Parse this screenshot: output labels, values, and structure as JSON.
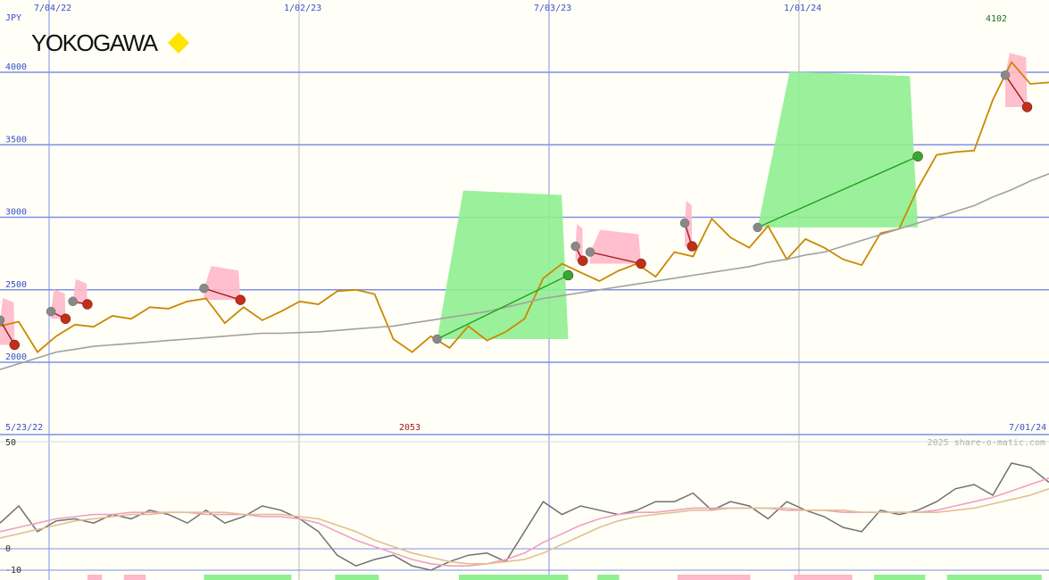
{
  "brand": {
    "name": "YOKOGAWA",
    "icon": "yellow-diamond-icon"
  },
  "colors": {
    "background": "#fffff8",
    "grid_major": "#7f8fe8",
    "grid_minor": "#b8b8b8",
    "price_line": "#cc8800",
    "moving_avg": "#a0a0a0",
    "up_fill": "#90f090",
    "down_fill": "#ffb8c8",
    "up_trend": "#22a022",
    "down_trend": "#a01818",
    "label_blue": "#3b4ec8",
    "label_red": "#a01818",
    "label_green": "#207020",
    "osc_main": "#707070",
    "osc_pink": "#f0a0c0",
    "osc_tan": "#e0c090"
  },
  "chart_data": [
    {
      "type": "line",
      "name": "price",
      "unit_label": "JPY",
      "x_tick_labels": [
        "7/04/22",
        "1/02/23",
        "7/03/23",
        "1/01/24"
      ],
      "y_ticks": [
        2000,
        2500,
        3000,
        3500,
        4000
      ],
      "ylim": [
        1970,
        4380
      ],
      "start_date_label": "5/23/22",
      "end_date_label": "7/01/24",
      "min_label": "2053",
      "max_label": "4102",
      "x_weeks": [
        0,
        2,
        4,
        6,
        8,
        10,
        12,
        14,
        16,
        18,
        20,
        22,
        24,
        26,
        28,
        30,
        32,
        34,
        36,
        38,
        40,
        42,
        44,
        46,
        48,
        50,
        52,
        54,
        56,
        58,
        60,
        62,
        64,
        66,
        68,
        70,
        72,
        74,
        76,
        78,
        80,
        82,
        84,
        86,
        88,
        90,
        92,
        94,
        96,
        98,
        100,
        102,
        104,
        106,
        108,
        110,
        112
      ],
      "series": [
        {
          "name": "price",
          "values": [
            2250,
            2280,
            2070,
            2180,
            2260,
            2245,
            2320,
            2300,
            2380,
            2370,
            2420,
            2440,
            2270,
            2380,
            2290,
            2350,
            2420,
            2400,
            2490,
            2500,
            2470,
            2160,
            2070,
            2180,
            2100,
            2250,
            2150,
            2210,
            2300,
            2580,
            2680,
            2620,
            2560,
            2630,
            2680,
            2590,
            2760,
            2730,
            2990,
            2860,
            2790,
            2940,
            2710,
            2850,
            2790,
            2710,
            2670,
            2890,
            2920,
            3200,
            3430,
            3450,
            3460,
            3810,
            4070,
            3920,
            3930
          ]
        },
        {
          "name": "moving average",
          "values": [
            1950,
            1990,
            2030,
            2070,
            2090,
            2110,
            2120,
            2130,
            2140,
            2150,
            2160,
            2170,
            2180,
            2190,
            2200,
            2200,
            2205,
            2210,
            2220,
            2230,
            2240,
            2250,
            2270,
            2290,
            2310,
            2330,
            2350,
            2380,
            2410,
            2440,
            2460,
            2480,
            2500,
            2520,
            2540,
            2560,
            2580,
            2600,
            2620,
            2640,
            2660,
            2690,
            2710,
            2740,
            2760,
            2800,
            2840,
            2880,
            2920,
            2960,
            3000,
            3040,
            3080,
            3140,
            3190,
            3250,
            3300
          ]
        }
      ],
      "trend_markers": [
        {
          "from": [
            0,
            2290
          ],
          "to": [
            2,
            2120
          ],
          "dir": "down"
        },
        {
          "from": [
            7,
            2350
          ],
          "to": [
            9,
            2300
          ],
          "dir": "down"
        },
        {
          "from": [
            10,
            2420
          ],
          "to": [
            12,
            2400
          ],
          "dir": "down"
        },
        {
          "from": [
            28,
            2510
          ],
          "to": [
            33,
            2430
          ],
          "dir": "down"
        },
        {
          "from": [
            60,
            2160
          ],
          "to": [
            78,
            2600
          ],
          "dir": "up"
        },
        {
          "from": [
            79,
            2800
          ],
          "to": [
            80,
            2700
          ],
          "dir": "down"
        },
        {
          "from": [
            81,
            2760
          ],
          "to": [
            88,
            2680
          ],
          "dir": "down"
        },
        {
          "from": [
            94,
            2960
          ],
          "to": [
            95,
            2800
          ],
          "dir": "down"
        },
        {
          "from": [
            104,
            2930
          ],
          "to": [
            126,
            3420
          ],
          "dir": "up"
        },
        {
          "from": [
            138,
            3980
          ],
          "to": [
            141,
            3760
          ],
          "dir": "down"
        }
      ]
    },
    {
      "type": "line",
      "name": "oscillator",
      "y_ticks": [
        50,
        0,
        -10
      ],
      "ylim": [
        -12,
        52
      ],
      "attribution": "2025 share-o-matic.com",
      "x_weeks": [
        0,
        2,
        4,
        6,
        8,
        10,
        12,
        14,
        16,
        18,
        20,
        22,
        24,
        26,
        28,
        30,
        32,
        34,
        36,
        38,
        40,
        42,
        44,
        46,
        48,
        50,
        52,
        54,
        56,
        58,
        60,
        62,
        64,
        66,
        68,
        70,
        72,
        74,
        76,
        78,
        80,
        82,
        84,
        86,
        88,
        90,
        92,
        94,
        96,
        98,
        100,
        102,
        104,
        106,
        108,
        110,
        112
      ],
      "series": [
        {
          "name": "main",
          "values": [
            12,
            20,
            8,
            13,
            14,
            12,
            16,
            14,
            18,
            16,
            12,
            18,
            12,
            15,
            20,
            18,
            14,
            8,
            -3,
            -8,
            -5,
            -3,
            -8,
            -10,
            -6,
            -3,
            -2,
            -6,
            8,
            22,
            16,
            20,
            18,
            16,
            18,
            22,
            22,
            26,
            18,
            22,
            20,
            14,
            22,
            18,
            15,
            10,
            8,
            18,
            16,
            18,
            22,
            28,
            30,
            25,
            40,
            38,
            31
          ]
        },
        {
          "name": "pink",
          "values": [
            8,
            10,
            12,
            14,
            15,
            16,
            16,
            17,
            17,
            17,
            17,
            16,
            16,
            16,
            15,
            15,
            14,
            12,
            8,
            4,
            1,
            -2,
            -5,
            -7,
            -8,
            -8,
            -7,
            -5,
            -2,
            3,
            7,
            11,
            14,
            16,
            17,
            17,
            18,
            19,
            19,
            19,
            19,
            19,
            18,
            18,
            18,
            17,
            17,
            17,
            17,
            17,
            18,
            20,
            22,
            24,
            27,
            30,
            33
          ]
        },
        {
          "name": "tan",
          "values": [
            5,
            7,
            9,
            11,
            13,
            14,
            15,
            16,
            16,
            17,
            17,
            17,
            17,
            16,
            16,
            16,
            15,
            14,
            11,
            8,
            4,
            1,
            -2,
            -4,
            -6,
            -7,
            -7,
            -6,
            -5,
            -2,
            2,
            6,
            10,
            13,
            15,
            16,
            17,
            18,
            18,
            19,
            19,
            19,
            19,
            18,
            18,
            18,
            17,
            17,
            17,
            17,
            17,
            18,
            19,
            21,
            23,
            25,
            28
          ]
        }
      ],
      "volume_bars": [
        {
          "from_week": 12,
          "to_week": 14,
          "sign": "down"
        },
        {
          "from_week": 17,
          "to_week": 20,
          "sign": "down"
        },
        {
          "from_week": 28,
          "to_week": 40,
          "sign": "up"
        },
        {
          "from_week": 46,
          "to_week": 52,
          "sign": "up"
        },
        {
          "from_week": 63,
          "to_week": 78,
          "sign": "up"
        },
        {
          "from_week": 82,
          "to_week": 85,
          "sign": "up"
        },
        {
          "from_week": 93,
          "to_week": 103,
          "sign": "down"
        },
        {
          "from_week": 109,
          "to_week": 117,
          "sign": "down"
        },
        {
          "from_week": 120,
          "to_week": 127,
          "sign": "up"
        },
        {
          "from_week": 130,
          "to_week": 143,
          "sign": "up"
        }
      ]
    }
  ]
}
